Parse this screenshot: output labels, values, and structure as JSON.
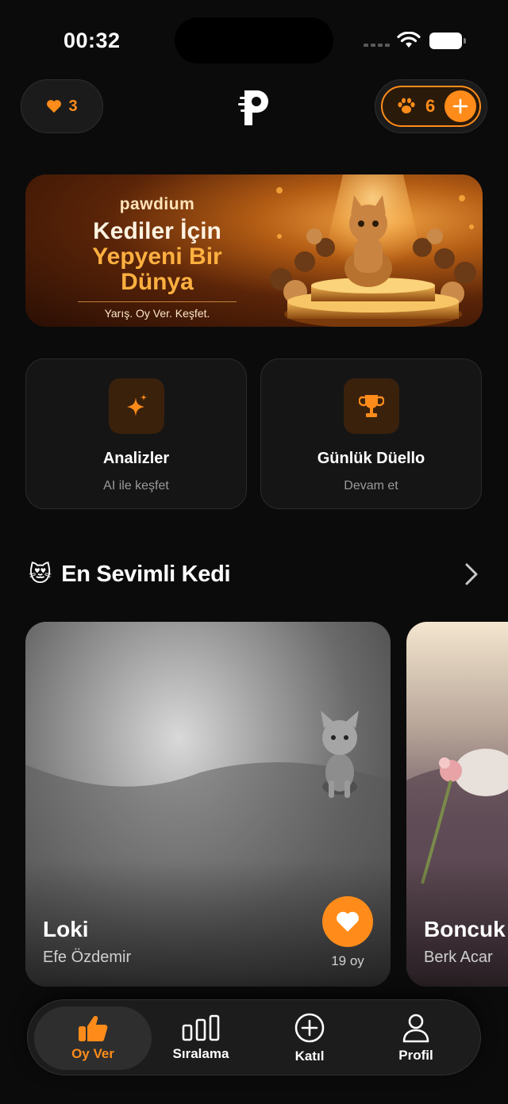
{
  "status_bar": {
    "time": "00:32"
  },
  "header": {
    "hearts_count": "3",
    "paws_count": "6"
  },
  "banner": {
    "brand": "pawdium",
    "headline_line1": "Kediler İçin",
    "headline_line2": "Yepyeni Bir Dünya",
    "tagline": "Yarış. Oy Ver. Keşfet."
  },
  "quick_actions": [
    {
      "title": "Analizler",
      "subtitle": "AI ile keşfet",
      "icon": "sparkles-icon"
    },
    {
      "title": "Günlük Düello",
      "subtitle": "Devam et",
      "icon": "trophy-icon"
    }
  ],
  "section": {
    "emoji": "😻",
    "title": "En Sevimli Kedi"
  },
  "cats": [
    {
      "name": "Loki",
      "owner": "Efe Özdemir",
      "votes": "19 oy"
    },
    {
      "name": "Boncuk",
      "owner": "Berk Acar"
    }
  ],
  "tab_bar": {
    "tabs": [
      {
        "label": "Oy Ver",
        "icon": "thumbs-up-icon",
        "active": true
      },
      {
        "label": "Sıralama",
        "icon": "bar-chart-icon",
        "active": false
      },
      {
        "label": "Katıl",
        "icon": "plus-circle-icon",
        "active": false
      },
      {
        "label": "Profil",
        "icon": "person-icon",
        "active": false
      }
    ]
  },
  "colors": {
    "accent": "#ff8c1a",
    "background": "#0b0b0b",
    "card": "#151515"
  }
}
